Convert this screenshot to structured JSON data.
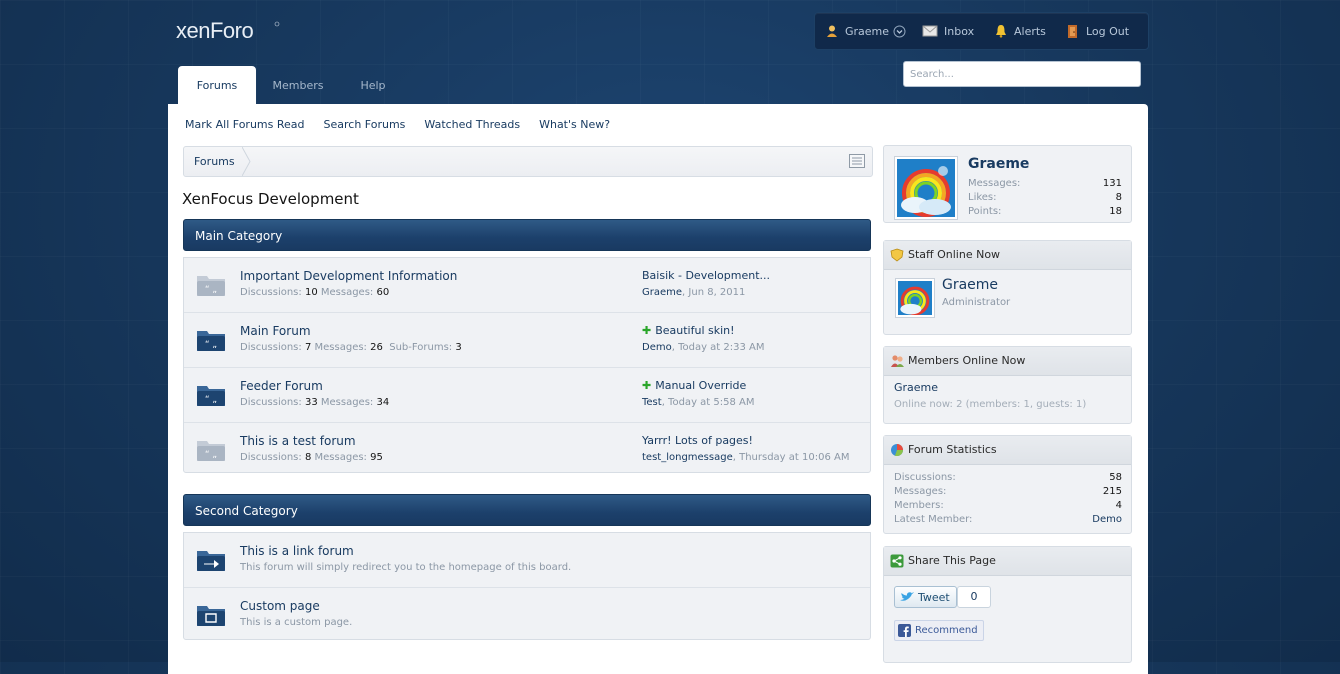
{
  "header": {
    "logo_text": "xenForo",
    "visitor": {
      "username": "Graeme",
      "inbox": "Inbox",
      "alerts": "Alerts",
      "logout": "Log Out"
    },
    "search_placeholder": "Search..."
  },
  "tabs": [
    {
      "label": "Forums",
      "active": true
    },
    {
      "label": "Members",
      "active": false
    },
    {
      "label": "Help",
      "active": false
    }
  ],
  "subnav": [
    "Mark All Forums Read",
    "Search Forums",
    "Watched Threads",
    "What's New?"
  ],
  "breadcrumb": {
    "label": "Forums"
  },
  "page_title": "XenFocus Development",
  "categories": [
    {
      "title": "Main Category",
      "nodes": [
        {
          "title": "Important Development Information",
          "discussions_label": "Discussions:",
          "discussions": "10",
          "messages_label": "Messages:",
          "messages": "60",
          "unread": false,
          "last_title": "Baisik - Development...",
          "last_new": false,
          "last_user": "Graeme",
          "last_date": ", Jun 8, 2011"
        },
        {
          "title": "Main Forum",
          "discussions_label": "Discussions:",
          "discussions": "7",
          "messages_label": "Messages:",
          "messages": "26",
          "subforums_label": "Sub-Forums:",
          "subforums": "3",
          "unread": true,
          "last_title": "Beautiful skin!",
          "last_new": true,
          "last_user": "Demo",
          "last_date": ", Today at 2:33 AM"
        },
        {
          "title": "Feeder Forum",
          "discussions_label": "Discussions:",
          "discussions": "33",
          "messages_label": "Messages:",
          "messages": "34",
          "unread": true,
          "last_title": "Manual Override",
          "last_new": true,
          "last_user": "Test",
          "last_date": ", Today at 5:58 AM"
        },
        {
          "title": "This is a test forum",
          "discussions_label": "Discussions:",
          "discussions": "8",
          "messages_label": "Messages:",
          "messages": "95",
          "unread": false,
          "last_title": "Yarrr! Lots of pages!",
          "last_new": false,
          "last_user": "test_longmessage",
          "last_date": ", Thursday at 10:06 AM"
        }
      ]
    },
    {
      "title": "Second Category",
      "links": [
        {
          "title": "This is a link forum",
          "desc": "This forum will simply redirect you to the homepage of this board."
        },
        {
          "title": "Custom page",
          "desc": "This is a custom page."
        }
      ]
    }
  ],
  "sidebar": {
    "profile": {
      "name": "Graeme",
      "stats": [
        {
          "k": "Messages:",
          "v": "131"
        },
        {
          "k": "Likes:",
          "v": "8"
        },
        {
          "k": "Points:",
          "v": "18"
        }
      ]
    },
    "staff": {
      "title": "Staff Online Now",
      "name": "Graeme",
      "role": "Administrator"
    },
    "members_online": {
      "title": "Members Online Now",
      "user": "Graeme",
      "summary": "Online now: 2 (members: 1, guests: 1)"
    },
    "stats": {
      "title": "Forum Statistics",
      "rows": [
        {
          "k": "Discussions:",
          "v": "58"
        },
        {
          "k": "Messages:",
          "v": "215"
        },
        {
          "k": "Members:",
          "v": "4"
        },
        {
          "k": "Latest Member:",
          "v": "Demo"
        }
      ]
    },
    "share": {
      "title": "Share This Page",
      "tweet": "Tweet",
      "tweet_count": "0",
      "recommend": "Recommend"
    }
  },
  "colors": {
    "accent": "#193b61",
    "background": "#163559",
    "new_marker": "#2aa62a"
  }
}
